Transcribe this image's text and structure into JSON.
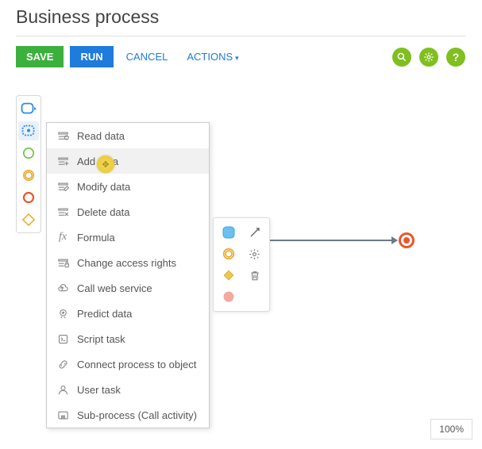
{
  "header": {
    "title": "Business process"
  },
  "toolbar": {
    "save": "SAVE",
    "run": "RUN",
    "cancel": "CANCEL",
    "actions": "ACTIONS"
  },
  "palette": {
    "items": [
      "task-blue",
      "task-blue-dashed",
      "event-green",
      "event-yellow",
      "event-red",
      "gateway-diamond"
    ],
    "selected_index": 1
  },
  "menu": {
    "items": [
      {
        "icon": "read",
        "label": "Read data"
      },
      {
        "icon": "add",
        "label": "Add data"
      },
      {
        "icon": "modify",
        "label": "Modify data"
      },
      {
        "icon": "delete",
        "label": "Delete data"
      },
      {
        "icon": "formula",
        "label": "Formula"
      },
      {
        "icon": "access",
        "label": "Change access rights"
      },
      {
        "icon": "web",
        "label": "Call web service"
      },
      {
        "icon": "predict",
        "label": "Predict data"
      },
      {
        "icon": "script",
        "label": "Script task"
      },
      {
        "icon": "link",
        "label": "Connect process to object"
      },
      {
        "icon": "user",
        "label": "User task"
      },
      {
        "icon": "sub",
        "label": "Sub-process (Call activity)"
      }
    ],
    "hover_index": 1
  },
  "context_toolbar": {
    "items": [
      "shape-blue",
      "pointer",
      "shape-yellow",
      "gear",
      "shape-diamond",
      "trash",
      "shape-pink",
      ""
    ]
  },
  "colors": {
    "green": "#3cb03c",
    "blue": "#1f7bdc",
    "link": "#1f7bdc",
    "lime": "#7fbf1f",
    "orange": "#e8572b"
  },
  "zoom": "100%"
}
